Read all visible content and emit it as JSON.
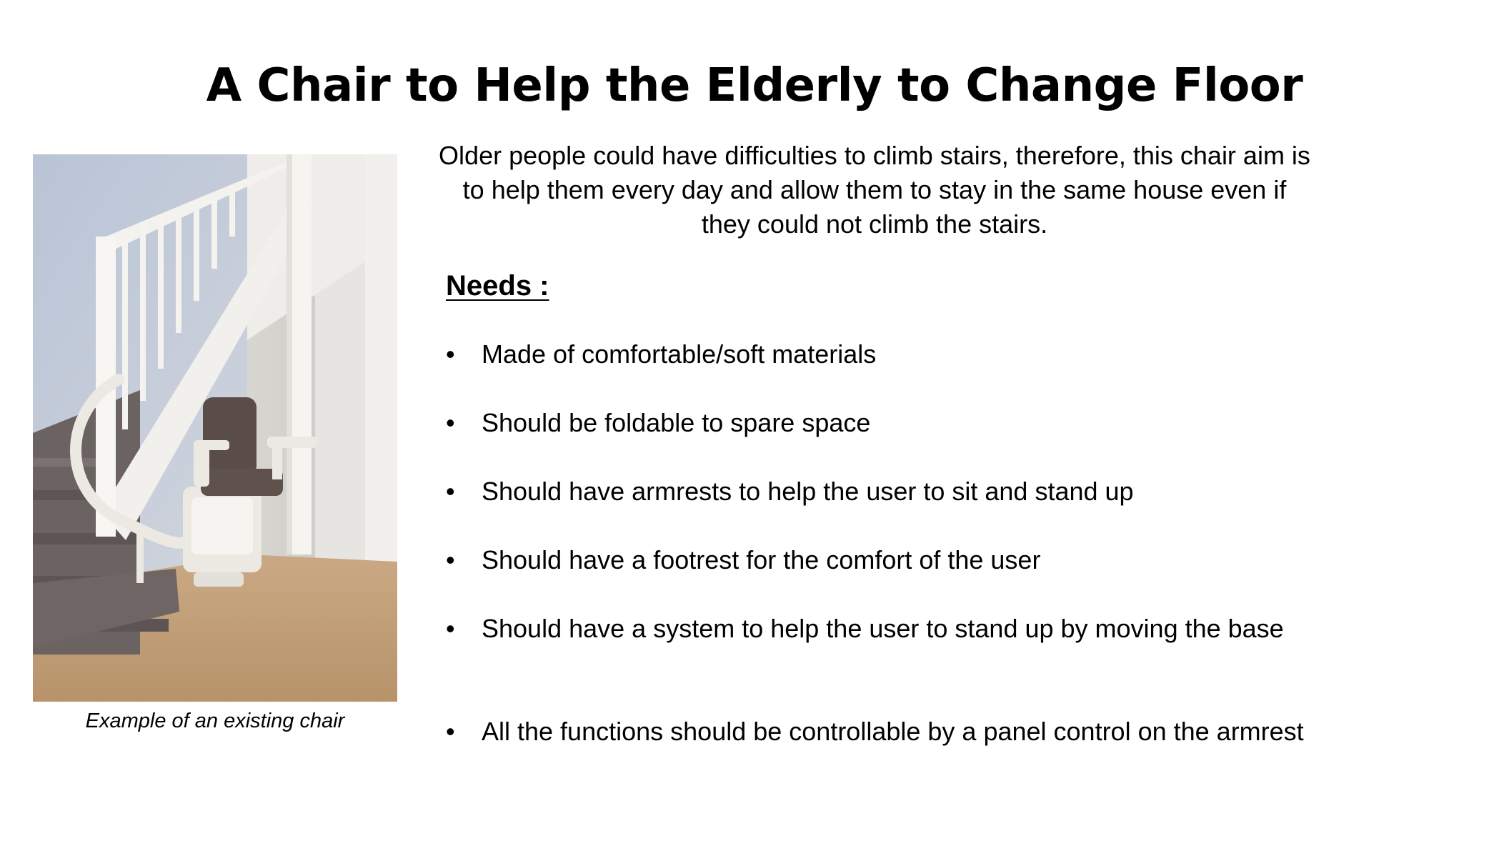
{
  "slide": {
    "title": "A Chair to Help the Elderly to Change Floor",
    "intro": "Older people could have difficulties to climb stairs, therefore, this chair aim is to help them every day and allow them to stay in the same house even if they could not climb the stairs.",
    "needs_heading": "Needs :",
    "bullet_glyph": "•",
    "needs": [
      "Made of comfortable/soft materials",
      "Should be foldable to spare space",
      "Should have armrests to help the user to sit and stand up",
      "Should have a footrest for the comfort of the user",
      "Should have a system to help the user to stand up by moving the base",
      "All the functions should be controllable by a panel control on the armrest"
    ]
  },
  "image": {
    "caption": "Example of an existing chair",
    "colors": {
      "wall": "#c9ced8",
      "floor": "#c8a47c",
      "carpet": "#6d6463",
      "railing": "#f2f0ec",
      "seat": "#5a4c47"
    }
  }
}
